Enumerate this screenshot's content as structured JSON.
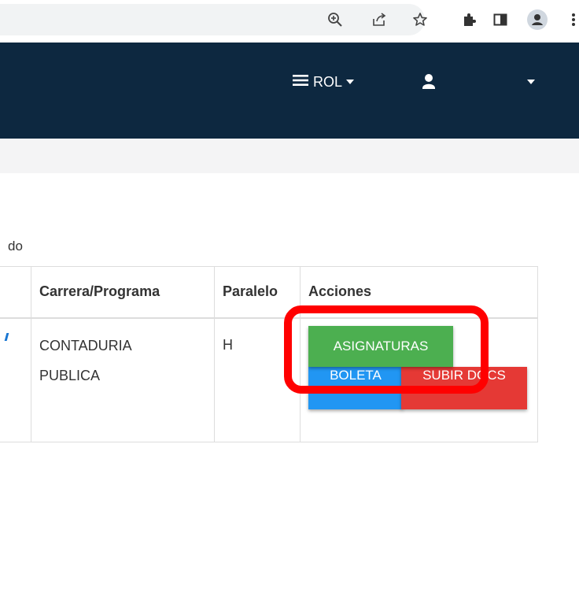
{
  "navbar": {
    "role_label": "ROL"
  },
  "caption": "do",
  "table": {
    "headers": [
      "Carrera/Programa",
      "Paralelo",
      "Acciones"
    ],
    "row": {
      "carrera": [
        "CONTADURIA",
        "PUBLICA"
      ],
      "paralelo": "H"
    }
  },
  "actions": {
    "asignaturas": "ASIGNATURAS",
    "boleta": "BOLETA",
    "subir_docs": "SUBIR DOCS"
  },
  "icons": [
    "zoom-icon",
    "share-icon",
    "star-icon",
    "extensions-icon",
    "side-panel-icon",
    "profile-icon",
    "more-menu-icon",
    "hamburger-icon",
    "user-icon",
    "caret-down-icon"
  ],
  "colors": {
    "navbar": "#0d2840",
    "green": "#4caf50",
    "blue": "#2196f3",
    "red": "#e53935",
    "highlight": "#ff0000"
  }
}
